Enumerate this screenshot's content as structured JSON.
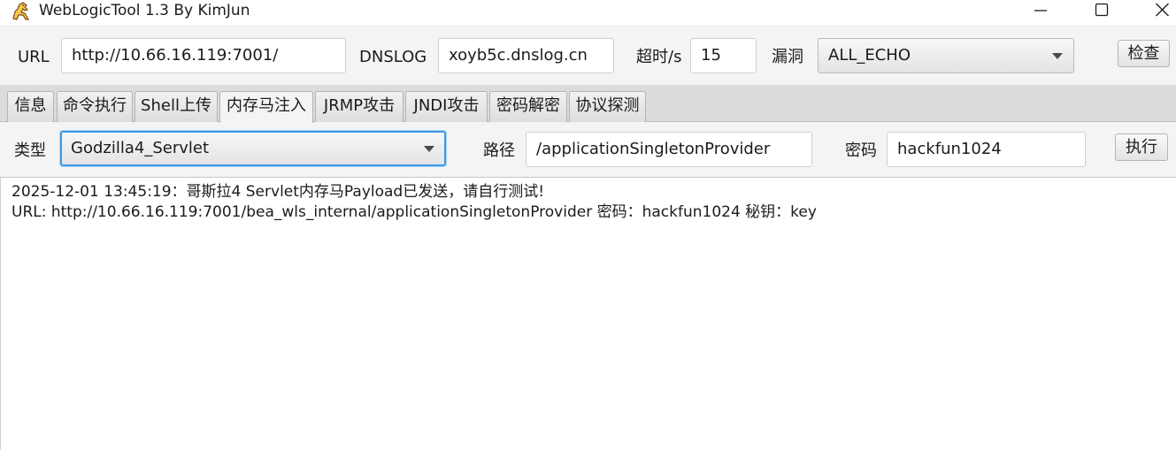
{
  "window": {
    "title": "WebLogicTool 1.3 By KimJun",
    "icon": "horse-app-icon",
    "controls": [
      "minimize-icon",
      "maximize-icon",
      "close-icon"
    ]
  },
  "toolbar": {
    "url_label": "URL",
    "url_value": "http://10.66.16.119:7001/",
    "dnslog_label": "DNSLOG",
    "dnslog_value": "xoyb5c.dnslog.cn",
    "timeout_label": "超时/s",
    "timeout_value": "15",
    "vuln_label": "漏洞",
    "vuln_value": "ALL_ECHO",
    "check_button": "检查"
  },
  "tabs": [
    {
      "label": "信息",
      "active": false
    },
    {
      "label": "命令执行",
      "active": false
    },
    {
      "label": "Shell上传",
      "active": false
    },
    {
      "label": "内存马注入",
      "active": true
    },
    {
      "label": "JRMP攻击",
      "active": false
    },
    {
      "label": "JNDI攻击",
      "active": false
    },
    {
      "label": "密码解密",
      "active": false
    },
    {
      "label": "协议探测",
      "active": false
    }
  ],
  "memshell": {
    "type_label": "类型",
    "type_value": "Godzilla4_Servlet",
    "path_label": "路径",
    "path_value": "/applicationSingletonProvider",
    "password_label": "密码",
    "password_value": "hackfun1024",
    "execute_button": "执行"
  },
  "output": {
    "lines": [
      "2025-12-01 13:45:19：哥斯拉4 Servlet内存马Payload已发送，请自行测试!",
      "URL: http://10.66.16.119:7001/bea_wls_internal/applicationSingletonProvider   密码：hackfun1024  秘钥：key"
    ]
  },
  "colors": {
    "focus_border": "#3c9ae8",
    "window_bg": "#f4f4f4",
    "tabstrip_bg": "#dcdcdc"
  }
}
